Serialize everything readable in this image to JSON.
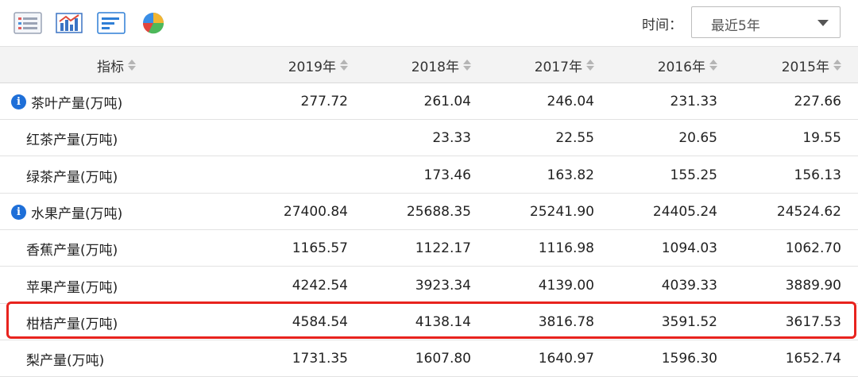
{
  "toolbar": {
    "buttons": [
      {
        "icon": "list-view-icon"
      },
      {
        "icon": "bar-chart-icon"
      },
      {
        "icon": "horizontal-bar-chart-icon"
      },
      {
        "icon": "pie-chart-icon"
      }
    ],
    "time_label": "时间：",
    "time_value": "最近5年"
  },
  "table": {
    "headers": [
      "指标",
      "2019年",
      "2018年",
      "2017年",
      "2016年",
      "2015年"
    ],
    "rows": [
      {
        "name": "茶叶产量(万吨)",
        "info": true,
        "values": [
          "277.72",
          "261.04",
          "246.04",
          "231.33",
          "227.66"
        ]
      },
      {
        "name": "红茶产量(万吨)",
        "info": false,
        "values": [
          "",
          "23.33",
          "22.55",
          "20.65",
          "19.55"
        ]
      },
      {
        "name": "绿茶产量(万吨)",
        "info": false,
        "values": [
          "",
          "173.46",
          "163.82",
          "155.25",
          "156.13"
        ]
      },
      {
        "name": "水果产量(万吨)",
        "info": true,
        "values": [
          "27400.84",
          "25688.35",
          "25241.90",
          "24405.24",
          "24524.62"
        ]
      },
      {
        "name": "香蕉产量(万吨)",
        "info": false,
        "values": [
          "1165.57",
          "1122.17",
          "1116.98",
          "1094.03",
          "1062.70"
        ]
      },
      {
        "name": "苹果产量(万吨)",
        "info": false,
        "values": [
          "4242.54",
          "3923.34",
          "4139.00",
          "4039.33",
          "3889.90"
        ]
      },
      {
        "name": "柑桔产量(万吨)",
        "info": false,
        "values": [
          "4584.54",
          "4138.14",
          "3816.78",
          "3591.52",
          "3617.53"
        ]
      },
      {
        "name": "梨产量(万吨)",
        "info": false,
        "values": [
          "1731.35",
          "1607.80",
          "1640.97",
          "1596.30",
          "1652.74"
        ]
      }
    ],
    "highlighted_row": "柑桔产量(万吨)"
  },
  "colors": {
    "highlight": "#e8231e",
    "info_icon": "#1e6fd8",
    "header_bg": "#f3f3f3"
  }
}
